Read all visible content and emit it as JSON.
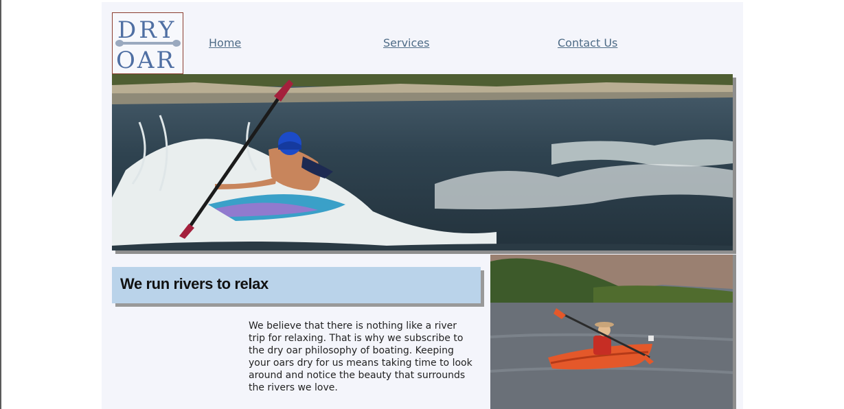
{
  "logo": {
    "line1": "DRY",
    "line2": "OAR",
    "color": "#4f6fa3"
  },
  "nav": {
    "items": [
      {
        "label": "Home"
      },
      {
        "label": "Services"
      },
      {
        "label": "Contact Us"
      }
    ],
    "link_color": "#4e6b86"
  },
  "hero": {
    "image": "kayaker-in-whitewater-photo"
  },
  "main": {
    "headline": "We run rivers to relax",
    "body": "We believe that there is nothing like a river trip for relaxing. That is why we subscribe to the dry oar philosophy of boating. Keeping your oars dry for us means taking time to look around and notice the beauty that surrounds the rivers we love.",
    "headline_bg": "#bad3ea"
  },
  "side": {
    "image": "child-in-orange-kayak-photo"
  }
}
